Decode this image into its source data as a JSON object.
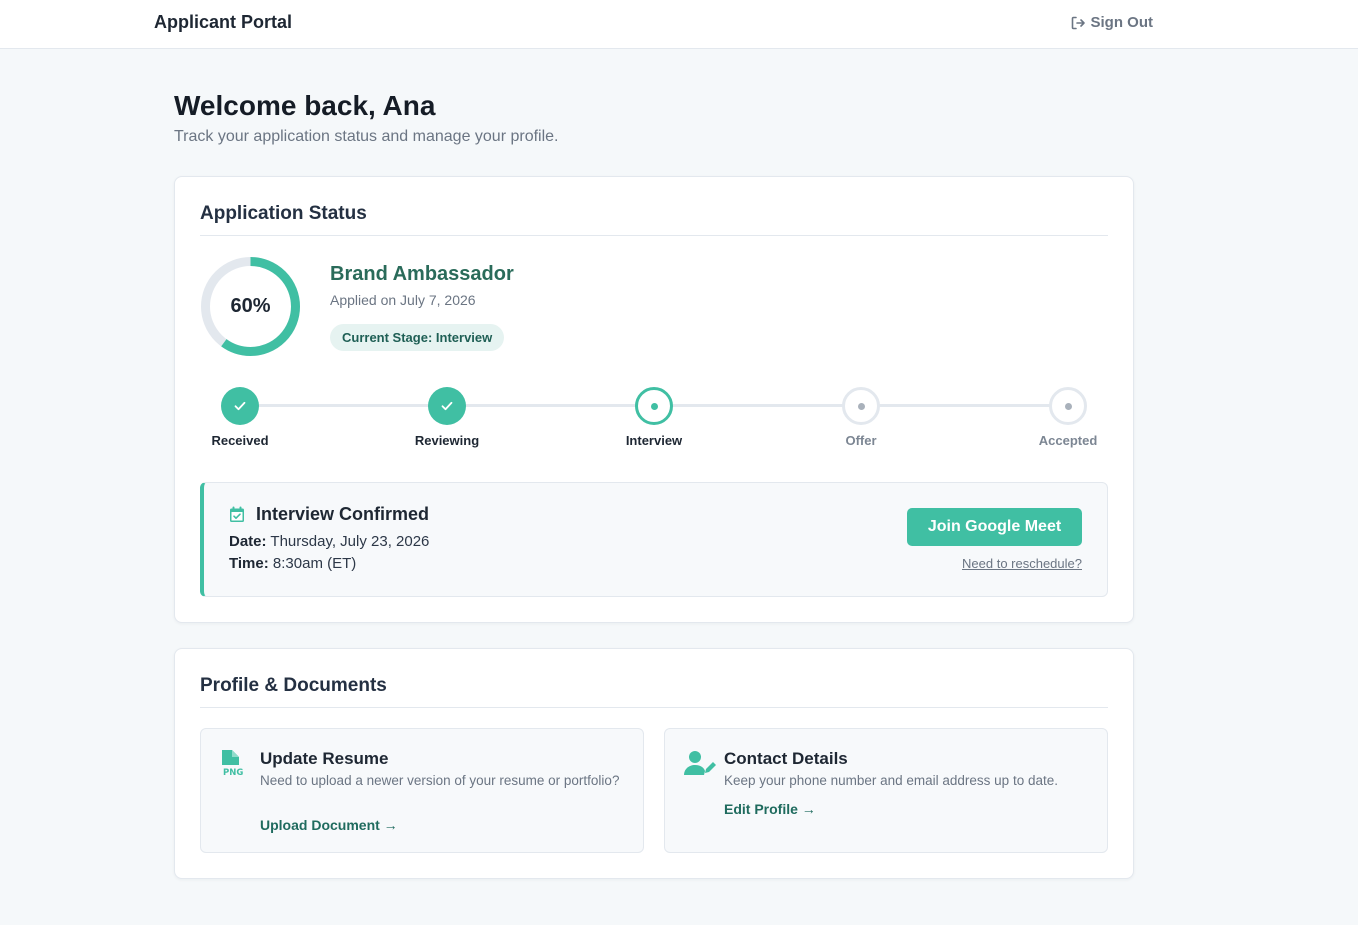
{
  "header": {
    "brand": "Applicant Portal",
    "sign_out_label": "Sign Out"
  },
  "welcome": {
    "title": "Welcome back, Ana",
    "subtitle": "Track your application status and manage your profile."
  },
  "status_card": {
    "title": "Application Status",
    "progress_percent": 60,
    "progress_label": "60%",
    "job_title": "Brand Ambassador",
    "applied_on": "Applied on July 7, 2026",
    "stage_pill": "Current Stage: Interview",
    "steps": [
      {
        "label": "Received",
        "state": "done"
      },
      {
        "label": "Reviewing",
        "state": "done"
      },
      {
        "label": "Interview",
        "state": "current"
      },
      {
        "label": "Offer",
        "state": "pending"
      },
      {
        "label": "Accepted",
        "state": "pending"
      }
    ],
    "interview": {
      "title": "Interview Confirmed",
      "date_label": "Date:",
      "date_value": "Thursday, July 23, 2026",
      "time_label": "Time:",
      "time_value": "8:30am (ET)",
      "join_button": "Join Google Meet",
      "reschedule_link": "Need to reschedule?"
    }
  },
  "profile_card": {
    "title": "Profile & Documents",
    "resume": {
      "icon": "file-png-icon",
      "title": "Update Resume",
      "description": "Need to upload a newer version of your resume or portfolio?",
      "link": "Upload Document →"
    },
    "contact": {
      "icon": "user-edit-icon",
      "title": "Contact Details",
      "description": "Keep your phone number and email address up to date.",
      "link": "Edit Profile →"
    }
  },
  "colors": {
    "accent": "#40bfa3",
    "accent_dark": "#2a6b5a",
    "track": "#e3e8ee"
  }
}
